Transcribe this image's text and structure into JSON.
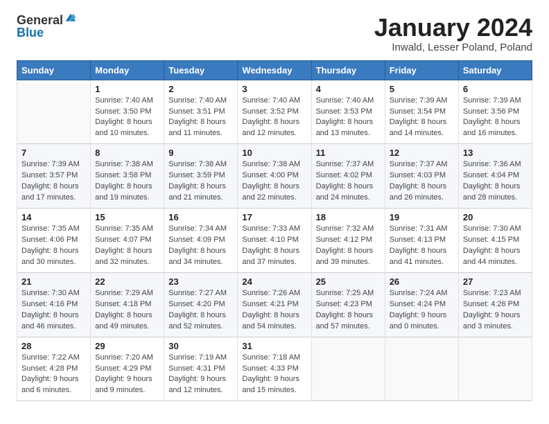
{
  "header": {
    "logo_general": "General",
    "logo_blue": "Blue",
    "month_title": "January 2024",
    "location": "Inwald, Lesser Poland, Poland"
  },
  "weekdays": [
    "Sunday",
    "Monday",
    "Tuesday",
    "Wednesday",
    "Thursday",
    "Friday",
    "Saturday"
  ],
  "weeks": [
    [
      {
        "day": "",
        "sunrise": "",
        "sunset": "",
        "daylight": ""
      },
      {
        "day": "1",
        "sunrise": "Sunrise: 7:40 AM",
        "sunset": "Sunset: 3:50 PM",
        "daylight": "Daylight: 8 hours and 10 minutes."
      },
      {
        "day": "2",
        "sunrise": "Sunrise: 7:40 AM",
        "sunset": "Sunset: 3:51 PM",
        "daylight": "Daylight: 8 hours and 11 minutes."
      },
      {
        "day": "3",
        "sunrise": "Sunrise: 7:40 AM",
        "sunset": "Sunset: 3:52 PM",
        "daylight": "Daylight: 8 hours and 12 minutes."
      },
      {
        "day": "4",
        "sunrise": "Sunrise: 7:40 AM",
        "sunset": "Sunset: 3:53 PM",
        "daylight": "Daylight: 8 hours and 13 minutes."
      },
      {
        "day": "5",
        "sunrise": "Sunrise: 7:39 AM",
        "sunset": "Sunset: 3:54 PM",
        "daylight": "Daylight: 8 hours and 14 minutes."
      },
      {
        "day": "6",
        "sunrise": "Sunrise: 7:39 AM",
        "sunset": "Sunset: 3:56 PM",
        "daylight": "Daylight: 8 hours and 16 minutes."
      }
    ],
    [
      {
        "day": "7",
        "sunrise": "Sunrise: 7:39 AM",
        "sunset": "Sunset: 3:57 PM",
        "daylight": "Daylight: 8 hours and 17 minutes."
      },
      {
        "day": "8",
        "sunrise": "Sunrise: 7:38 AM",
        "sunset": "Sunset: 3:58 PM",
        "daylight": "Daylight: 8 hours and 19 minutes."
      },
      {
        "day": "9",
        "sunrise": "Sunrise: 7:38 AM",
        "sunset": "Sunset: 3:59 PM",
        "daylight": "Daylight: 8 hours and 21 minutes."
      },
      {
        "day": "10",
        "sunrise": "Sunrise: 7:38 AM",
        "sunset": "Sunset: 4:00 PM",
        "daylight": "Daylight: 8 hours and 22 minutes."
      },
      {
        "day": "11",
        "sunrise": "Sunrise: 7:37 AM",
        "sunset": "Sunset: 4:02 PM",
        "daylight": "Daylight: 8 hours and 24 minutes."
      },
      {
        "day": "12",
        "sunrise": "Sunrise: 7:37 AM",
        "sunset": "Sunset: 4:03 PM",
        "daylight": "Daylight: 8 hours and 26 minutes."
      },
      {
        "day": "13",
        "sunrise": "Sunrise: 7:36 AM",
        "sunset": "Sunset: 4:04 PM",
        "daylight": "Daylight: 8 hours and 28 minutes."
      }
    ],
    [
      {
        "day": "14",
        "sunrise": "Sunrise: 7:35 AM",
        "sunset": "Sunset: 4:06 PM",
        "daylight": "Daylight: 8 hours and 30 minutes."
      },
      {
        "day": "15",
        "sunrise": "Sunrise: 7:35 AM",
        "sunset": "Sunset: 4:07 PM",
        "daylight": "Daylight: 8 hours and 32 minutes."
      },
      {
        "day": "16",
        "sunrise": "Sunrise: 7:34 AM",
        "sunset": "Sunset: 4:09 PM",
        "daylight": "Daylight: 8 hours and 34 minutes."
      },
      {
        "day": "17",
        "sunrise": "Sunrise: 7:33 AM",
        "sunset": "Sunset: 4:10 PM",
        "daylight": "Daylight: 8 hours and 37 minutes."
      },
      {
        "day": "18",
        "sunrise": "Sunrise: 7:32 AM",
        "sunset": "Sunset: 4:12 PM",
        "daylight": "Daylight: 8 hours and 39 minutes."
      },
      {
        "day": "19",
        "sunrise": "Sunrise: 7:31 AM",
        "sunset": "Sunset: 4:13 PM",
        "daylight": "Daylight: 8 hours and 41 minutes."
      },
      {
        "day": "20",
        "sunrise": "Sunrise: 7:30 AM",
        "sunset": "Sunset: 4:15 PM",
        "daylight": "Daylight: 8 hours and 44 minutes."
      }
    ],
    [
      {
        "day": "21",
        "sunrise": "Sunrise: 7:30 AM",
        "sunset": "Sunset: 4:16 PM",
        "daylight": "Daylight: 8 hours and 46 minutes."
      },
      {
        "day": "22",
        "sunrise": "Sunrise: 7:29 AM",
        "sunset": "Sunset: 4:18 PM",
        "daylight": "Daylight: 8 hours and 49 minutes."
      },
      {
        "day": "23",
        "sunrise": "Sunrise: 7:27 AM",
        "sunset": "Sunset: 4:20 PM",
        "daylight": "Daylight: 8 hours and 52 minutes."
      },
      {
        "day": "24",
        "sunrise": "Sunrise: 7:26 AM",
        "sunset": "Sunset: 4:21 PM",
        "daylight": "Daylight: 8 hours and 54 minutes."
      },
      {
        "day": "25",
        "sunrise": "Sunrise: 7:25 AM",
        "sunset": "Sunset: 4:23 PM",
        "daylight": "Daylight: 8 hours and 57 minutes."
      },
      {
        "day": "26",
        "sunrise": "Sunrise: 7:24 AM",
        "sunset": "Sunset: 4:24 PM",
        "daylight": "Daylight: 9 hours and 0 minutes."
      },
      {
        "day": "27",
        "sunrise": "Sunrise: 7:23 AM",
        "sunset": "Sunset: 4:26 PM",
        "daylight": "Daylight: 9 hours and 3 minutes."
      }
    ],
    [
      {
        "day": "28",
        "sunrise": "Sunrise: 7:22 AM",
        "sunset": "Sunset: 4:28 PM",
        "daylight": "Daylight: 9 hours and 6 minutes."
      },
      {
        "day": "29",
        "sunrise": "Sunrise: 7:20 AM",
        "sunset": "Sunset: 4:29 PM",
        "daylight": "Daylight: 9 hours and 9 minutes."
      },
      {
        "day": "30",
        "sunrise": "Sunrise: 7:19 AM",
        "sunset": "Sunset: 4:31 PM",
        "daylight": "Daylight: 9 hours and 12 minutes."
      },
      {
        "day": "31",
        "sunrise": "Sunrise: 7:18 AM",
        "sunset": "Sunset: 4:33 PM",
        "daylight": "Daylight: 9 hours and 15 minutes."
      },
      {
        "day": "",
        "sunrise": "",
        "sunset": "",
        "daylight": ""
      },
      {
        "day": "",
        "sunrise": "",
        "sunset": "",
        "daylight": ""
      },
      {
        "day": "",
        "sunrise": "",
        "sunset": "",
        "daylight": ""
      }
    ]
  ]
}
